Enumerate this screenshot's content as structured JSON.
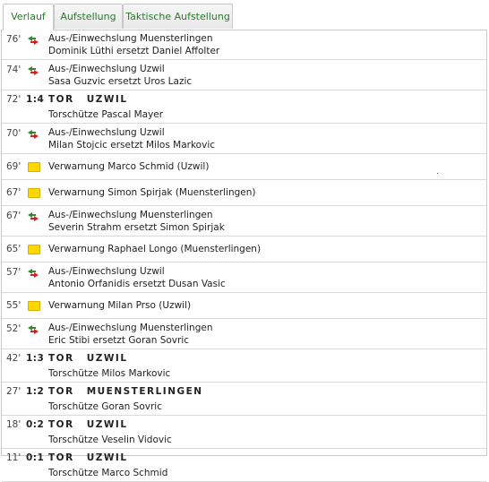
{
  "tabs": [
    "Verlauf",
    "Aufstellung",
    "Taktische Aufstellung"
  ],
  "events": [
    {
      "minute": "76'",
      "type": "sub",
      "line1": "Aus-/Einwechslung Muensterlingen",
      "line2": "Dominik Lüthi ersetzt Daniel Affolter"
    },
    {
      "minute": "74'",
      "type": "sub",
      "line1": "Aus-/Einwechslung Uzwil",
      "line2": "Sasa Guzvic ersetzt Uros Lazic"
    },
    {
      "minute": "72'",
      "type": "goal",
      "score": "1:4",
      "label": "TOR",
      "team": "UZWIL",
      "scorer": "Torschütze Pascal Mayer"
    },
    {
      "minute": "70'",
      "type": "sub",
      "line1": "Aus-/Einwechslung Uzwil",
      "line2": "Milan Stojcic ersetzt Milos Markovic"
    },
    {
      "minute": "69'",
      "type": "card",
      "line1": "Verwarnung Marco Schmid (Uzwil)"
    },
    {
      "minute": "67'",
      "type": "card",
      "line1": "Verwarnung Simon Spirjak (Muensterlingen)"
    },
    {
      "minute": "67'",
      "type": "sub",
      "line1": "Aus-/Einwechslung Muensterlingen",
      "line2": "Severin Strahm ersetzt Simon Spirjak"
    },
    {
      "minute": "65'",
      "type": "card",
      "line1": "Verwarnung Raphael Longo (Muensterlingen)"
    },
    {
      "minute": "57'",
      "type": "sub",
      "line1": "Aus-/Einwechslung Uzwil",
      "line2": "Antonio Orfanidis ersetzt Dusan Vasic"
    },
    {
      "minute": "55'",
      "type": "card",
      "line1": "Verwarnung Milan Prso (Uzwil)"
    },
    {
      "minute": "52'",
      "type": "sub",
      "line1": "Aus-/Einwechslung Muensterlingen",
      "line2": "Eric Stibi ersetzt Goran Sovric"
    },
    {
      "minute": "42'",
      "type": "goal",
      "score": "1:3",
      "label": "TOR",
      "team": "UZWIL",
      "scorer": "Torschütze Milos Markovic"
    },
    {
      "minute": "27'",
      "type": "goal",
      "score": "1:2",
      "label": "TOR",
      "team": "MUENSTERLINGEN",
      "scorer": "Torschütze Goran Sovric"
    },
    {
      "minute": "18'",
      "type": "goal",
      "score": "0:2",
      "label": "TOR",
      "team": "UZWIL",
      "scorer": "Torschütze Veselin Vidovic"
    },
    {
      "minute": "11'",
      "type": "goal",
      "score": "0:1",
      "label": "TOR",
      "team": "UZWIL",
      "scorer": "Torschütze Marco Schmid"
    }
  ],
  "colors": {
    "tab_text": "#2a7a2a",
    "card": "#ffd700",
    "sub_in": "#2e8b2e",
    "sub_out": "#c62828"
  }
}
